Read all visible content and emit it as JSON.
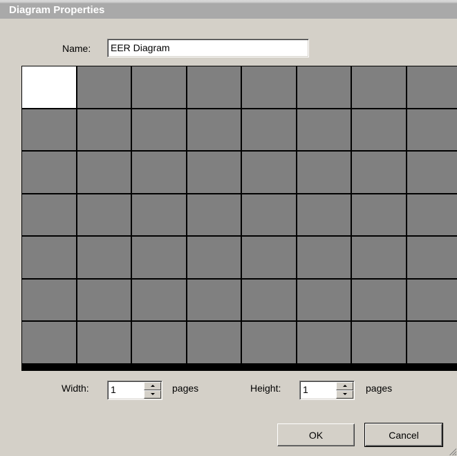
{
  "window": {
    "title": "Diagram Properties"
  },
  "name_field": {
    "label": "Name:",
    "value": "EER Diagram"
  },
  "page_grid": {
    "columns": 8,
    "rows": 7,
    "selected": {
      "columns": 1,
      "rows": 1
    }
  },
  "width_field": {
    "label": "Width:",
    "value": "1",
    "unit": "pages"
  },
  "height_field": {
    "label": "Height:",
    "value": "1",
    "unit": "pages"
  },
  "buttons": {
    "ok": "OK",
    "cancel": "Cancel"
  }
}
